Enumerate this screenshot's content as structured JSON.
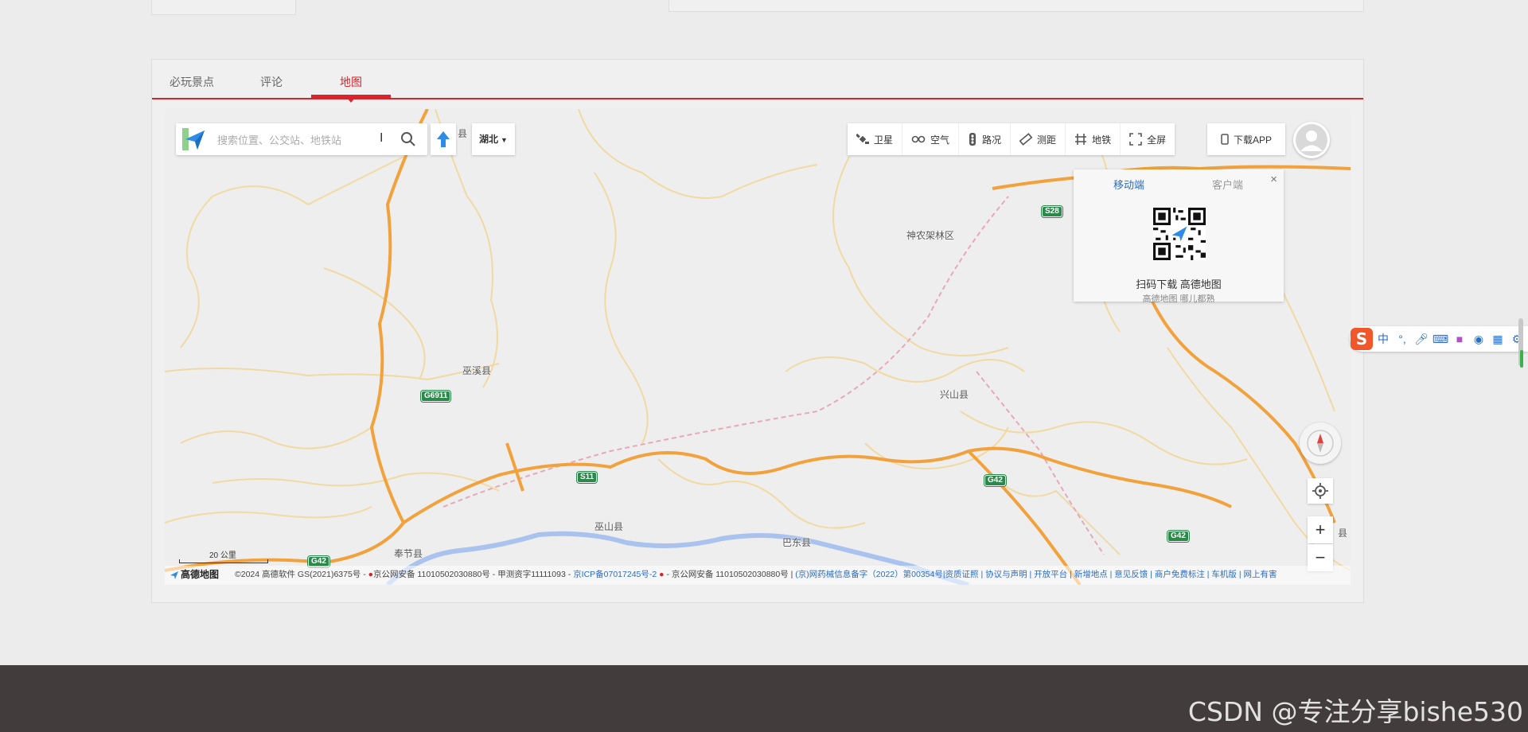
{
  "tabs": [
    {
      "label": "必玩景点",
      "active": false
    },
    {
      "label": "评论",
      "active": false
    },
    {
      "label": "地图",
      "active": true
    }
  ],
  "colors": {
    "accent": "#d8242c",
    "link": "#2a6dc9",
    "footer": "#433c3c"
  },
  "search": {
    "placeholder": "搜索位置、公交站、地铁站",
    "city": "湖北",
    "partial_label": "县"
  },
  "toolbar": {
    "items": [
      {
        "label": "卫星",
        "icon": "satellite-icon"
      },
      {
        "label": "空气",
        "icon": "air-icon"
      },
      {
        "label": "路况",
        "icon": "traffic-light-icon"
      },
      {
        "label": "测距",
        "icon": "ruler-icon"
      },
      {
        "label": "地铁",
        "icon": "subway-icon"
      },
      {
        "label": "全屏",
        "icon": "fullscreen-icon"
      }
    ],
    "download": "下载APP"
  },
  "qr_popup": {
    "tab_mobile": "移动端",
    "tab_client": "客户端",
    "close": "×",
    "title": "扫码下载 高德地图",
    "subtitle": "高德地图 哪儿都熟"
  },
  "places": {
    "shennongjia": "神农架林区",
    "wuxi": "巫溪县",
    "xingshan": "兴山县",
    "wushan": "巫山县",
    "badong": "巴东县",
    "fengjie": "奉节县",
    "edge": "县"
  },
  "shields": {
    "g6911": "G6911",
    "s11": "S11",
    "g42a": "G42",
    "g42b": "G42",
    "g42c": "G42",
    "s28": "S28"
  },
  "controls": {
    "zoom_in": "+",
    "zoom_out": "−"
  },
  "scale": {
    "label": "20 公里"
  },
  "copyright": {
    "brand": "高德地图",
    "text": "©2024 高德软件 GS(2021)6375号 - ",
    "beian1": "京公网安备 11010502030880号 - 甲测资字11111093 - ",
    "icp": "京ICP备07017245号-2",
    "beian2": " - 京公网安备 11010502030880号 | ",
    "links": "(京)网药械信息备字（2022）第00354号|资质证照 | 协议与声明 | 开放平台 | 新增地点 | 意见反馈 | 商户免费标注 | 车机版 | 网上有害"
  },
  "ime": {
    "lang": "中",
    "punct": "°,"
  },
  "watermark": "CSDN @专注分享bishe530"
}
